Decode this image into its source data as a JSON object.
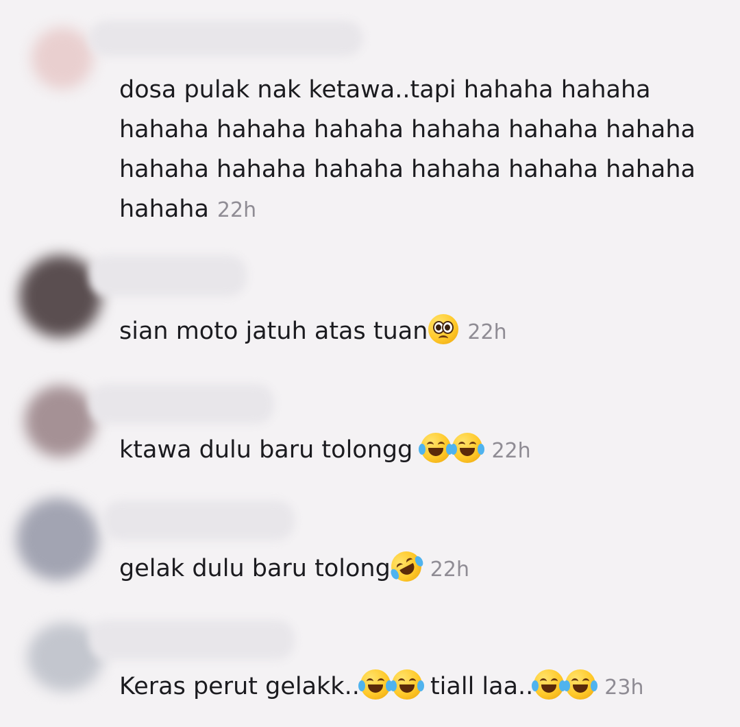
{
  "comments": [
    {
      "text": "dosa pulak nak ketawa..tapi hahaha hahaha hahaha hahaha hahaha hahaha hahaha hahaha hahaha hahaha hahaha hahaha hahaha hahaha hahaha",
      "time": "22h",
      "avatar_color": "#e9cfcf"
    },
    {
      "text": "sian moto jatuh atas tuan",
      "emoji": [
        "pleading-face-icon"
      ],
      "time": "22h",
      "avatar_color": "#5a4e50"
    },
    {
      "text": "ktawa dulu baru tolongg ",
      "emoji": [
        "face-with-tears-of-joy-icon",
        "face-with-tears-of-joy-icon"
      ],
      "time": "22h",
      "avatar_color": "#a59195"
    },
    {
      "text": "gelak dulu baru tolong",
      "emoji": [
        "rolling-on-floor-laughing-icon"
      ],
      "time": "22h",
      "avatar_color": "#a2a4b2"
    },
    {
      "text_a": "Keras perut gelakk..",
      "text_b": " tiall laa..",
      "emoji": [
        "face-with-tears-of-joy-icon",
        "face-with-tears-of-joy-icon",
        "face-with-tears-of-joy-icon",
        "face-with-tears-of-joy-icon"
      ],
      "time": "23h",
      "avatar_color": "#c3c6ce"
    }
  ]
}
